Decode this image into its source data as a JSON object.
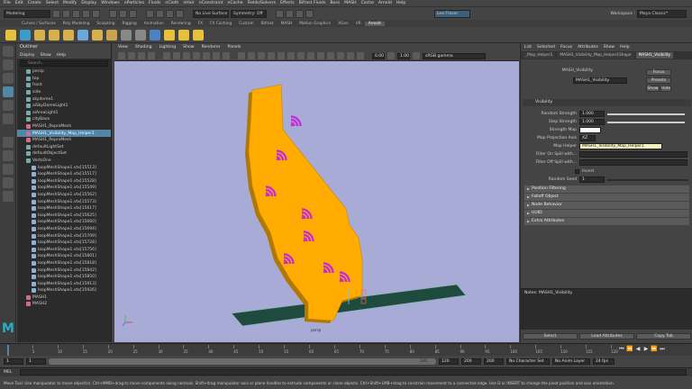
{
  "menubar": [
    "File",
    "Edit",
    "Create",
    "Select",
    "Modify",
    "Display",
    "Windows",
    "nParticles",
    "Fluids",
    "nCloth",
    "nHair",
    "nConstraint",
    "nCache",
    "Fields/Solvers",
    "Effects",
    "Bifrost Fluids",
    "Boss",
    "MASH",
    "Cache",
    "Arnold",
    "Help"
  ],
  "workspace": {
    "label": "Workspace :",
    "value": "Maya Classic*"
  },
  "status": {
    "surface": "No Live Surface",
    "symmetry": "Symmetry: Off",
    "user": "Lee Fraser"
  },
  "shelf_tabs": [
    "Curves / Surfaces",
    "Poly Modeling",
    "Sculpting",
    "Rigging",
    "Animation",
    "Rendering",
    "FX",
    "FX Caching",
    "Custom",
    "Bifrost",
    "MASH",
    "Motion Graphics",
    "XGen",
    "VR",
    "Arnold"
  ],
  "shelf_active": "Arnold",
  "outliner": {
    "title": "Outliner",
    "menu": [
      "Display",
      "Show",
      "Help"
    ],
    "search": "Search...",
    "items": [
      "persp",
      "top",
      "front",
      "side",
      "skydome1",
      "aiSkyDomeLight1",
      "aiAreaLight1",
      "cityBase",
      "MASH1_ReproMesh",
      "MASH1_Visibility_Map_Helper1",
      "MASH1_ReproMesh",
      "defaultLightSet",
      "defaultObjectSet",
      "VertsOne",
      "loopMeshShape1.vtx[15513]",
      "loopMeshShape1.vtx[15517]",
      "loopMeshShape1.vtx[15528]",
      "loopMeshShape1.vtx[15549]",
      "loopMeshShape1.vtx[15562]",
      "loopMeshShape1.vtx[15573]",
      "loopMeshShape1.vtx[15617]",
      "loopMeshShape1.vtx[15625]",
      "loopMeshShape1.vtx[15660]",
      "loopMeshShape1.vtx[15694]",
      "loopMeshShape1.vtx[15709]",
      "loopMeshShape1.vtx[15728]",
      "loopMeshShape1.vtx[15756]",
      "loopMeshShape1.vtx[15801]",
      "loopMeshShape1.vtx[15818]",
      "loopMeshShape1.vtx[15842]",
      "loopMeshShape1.vtx[15850]",
      "loopMeshShape1.vtx[15913]",
      "loopMeshShape1.vtx[15926]",
      "MASH1",
      "MASH2"
    ],
    "selected_index": 9
  },
  "viewport": {
    "menu": [
      "View",
      "Shading",
      "Lighting",
      "Show",
      "Renderer",
      "Panels"
    ],
    "exposure": "0.00",
    "gamma": "1.00",
    "colorspace": "sRGB gamma",
    "camera": "persp"
  },
  "attr": {
    "menu": [
      "List",
      "Selected",
      "Focus",
      "Attributes",
      "Show",
      "Help"
    ],
    "tabs": [
      "_Map_Helper1",
      "MASH1_Visibility_Map_Helper1Shape",
      "MASH1_Visibility"
    ],
    "node_label": "MASH_Visibility",
    "node_value": "MASH1_Visibility",
    "buttons": [
      "Focus",
      "Presets",
      "Show",
      "Hide"
    ],
    "section": "Visibility",
    "fields": [
      {
        "label": "Random Strength",
        "value": "1.000"
      },
      {
        "label": "Step Strength",
        "value": "1.000"
      },
      {
        "label": "Strength Map",
        "value": ""
      },
      {
        "label": "Map Projection Axis",
        "value": "XZ"
      },
      {
        "label": "Map Helper",
        "value": "MASH1_Visibility_Map_Helper1"
      },
      {
        "label": "Filter On Spill with...",
        "value": ""
      },
      {
        "label": "Filter Off Spill with...",
        "value": ""
      }
    ],
    "invert": "Invert",
    "random_seed_label": "Random Seed",
    "random_seed": "1",
    "collapsed": [
      "Position Filtering",
      "Falloff Object",
      "Node Behavior",
      "UUID",
      "Extra Attributes"
    ],
    "notes": "Notes: MASH1_Visibility",
    "bottom_buttons": [
      "Select",
      "Load Attributes",
      "Copy Tab"
    ]
  },
  "time": {
    "ticks": [
      "1",
      "5",
      "10",
      "15",
      "20",
      "25",
      "30",
      "35",
      "40",
      "45",
      "50",
      "55",
      "60",
      "65",
      "70",
      "75",
      "80",
      "85",
      "90",
      "95",
      "100",
      "105",
      "110",
      "115",
      "120"
    ],
    "current": "1",
    "start": "1",
    "end": "120",
    "range_end": "200",
    "range_end2": "200",
    "char_set": "No Character Set",
    "anim_layer": "No Anim Layer",
    "fps": "24 fps"
  },
  "cmd": {
    "label": "MEL"
  },
  "help": "Move Tool: Use manipulator to move object(s). Ctrl+MMB+drag to move components along normals. Shift+drag manipulator axis or plane handles to extrude components or clone objects. Ctrl+Shift+LMB+drag to constrain movement to a connected edge. Use D or INSERT to change the pivot position and axis orientation.",
  "colors": {
    "map": "#ffab00",
    "bars": "#c52ed6",
    "grid": "#1f4a3e",
    "selection": "#5285a6",
    "viewport": "#a7abd6"
  }
}
